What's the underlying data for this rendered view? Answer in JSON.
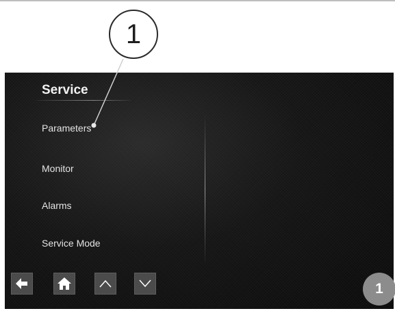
{
  "callout": {
    "label": "1"
  },
  "screen": {
    "title": "Service",
    "menu": [
      {
        "label": "Parameters"
      },
      {
        "label": "Monitor"
      },
      {
        "label": "Alarms"
      },
      {
        "label": "Service Mode"
      }
    ]
  },
  "nav": {
    "icons": [
      "back-arrow-icon",
      "home-icon",
      "chevron-up-icon",
      "chevron-down-icon"
    ]
  },
  "figure_badge": {
    "label": "1"
  },
  "colors": {
    "screen_bg": "#151515",
    "button_bg": "#4b4b4b",
    "badge_bg": "#8c8c8c",
    "text": "#e4e4e4"
  }
}
